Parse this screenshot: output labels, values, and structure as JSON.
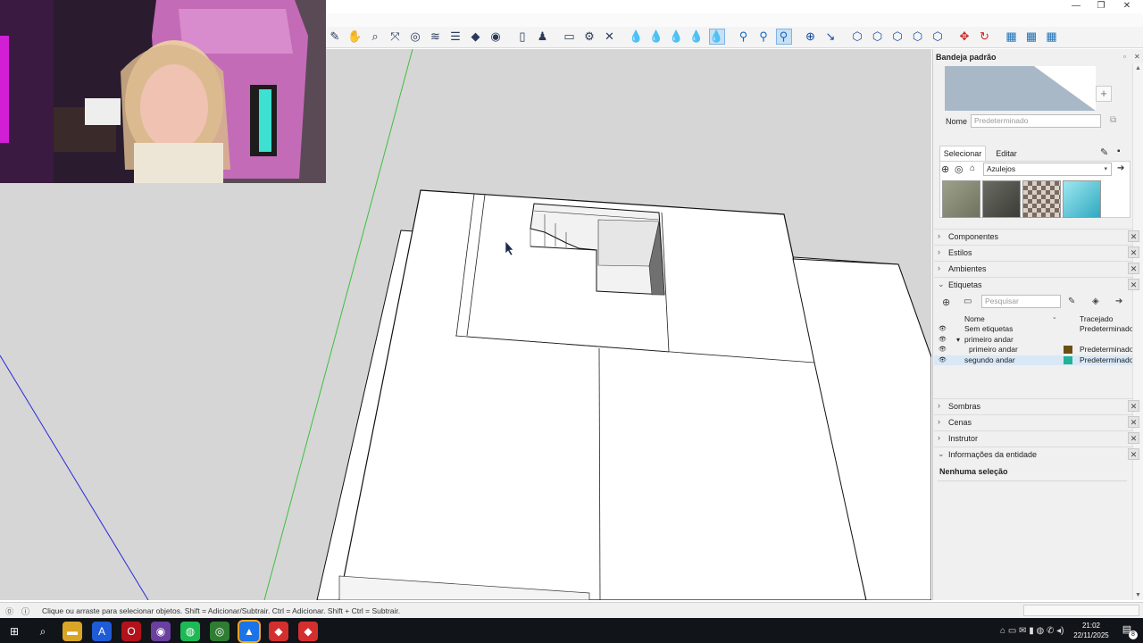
{
  "window": {
    "minimize": "—",
    "restore": "❐",
    "close": "✕"
  },
  "toolbar": {
    "icons": [
      "erase-icon",
      "pan-icon",
      "zoom-icon",
      "zoom-extents-icon",
      "orbit-icon",
      "section-icon",
      "layers-icon",
      "materials-icon",
      "camera-icon",
      "new-icon",
      "user-icon",
      "rectangle-icon",
      "settings-icon",
      "delete-icon",
      "drop-icon",
      "drop-icon",
      "drop-icon",
      "drop-icon",
      "drop-icon",
      "magnet-icon",
      "magnet-icon",
      "magnet-icon",
      "add-icon",
      "measure-icon",
      "box-icon",
      "box-icon",
      "box-icon",
      "box-icon",
      "box-icon",
      "move-icon",
      "rotate-icon",
      "grid-icon",
      "grid-icon",
      "grid-icon"
    ]
  },
  "tray": {
    "title": "Bandeja padrão",
    "name_label": "Nome",
    "name_placeholder": "Predeterminado",
    "tab_select": "Selecionar",
    "tab_edit": "Editar",
    "library": "Azulejos",
    "materials": [
      "mat-stone",
      "mat-dark-stone",
      "mat-checker",
      "mat-ice"
    ],
    "sections_collapsed_top": [
      "Componentes",
      "Estilos",
      "Ambientes"
    ],
    "tags_section": "Etiquetas",
    "tags_search_placeholder": "Pesquisar",
    "tags_col_name": "Nome",
    "tags_col_dashes": "Tracejado",
    "tags": [
      {
        "name": "Sem etiquetas",
        "dash": "Predeterminado",
        "color": "",
        "indent": 0
      },
      {
        "name": "primeiro andar",
        "dash": "",
        "color": "",
        "indent": 0,
        "group": true
      },
      {
        "name": "primeiro andar",
        "dash": "Predeterminado",
        "color": "#6b4e12",
        "indent": 1
      },
      {
        "name": "segundo andar",
        "dash": "Predeterminado",
        "color": "#1fb49a",
        "indent": 0,
        "selected": true
      }
    ],
    "sections_collapsed_bottom": [
      "Sombras",
      "Cenas",
      "Instrutor"
    ],
    "entity_section": "Informações da entidade",
    "entity_text": "Nenhuma seleção"
  },
  "status": {
    "text": "Clique ou arraste para selecionar objetos. Shift = Adicionar/Subtrair. Ctrl = Adicionar. Shift + Ctrl = Subtrair."
  },
  "taskbar": {
    "time": "21:02",
    "date": "22/11/2025",
    "notification_count": "8",
    "apps": [
      "windows-icon",
      "search-icon",
      "folder-icon",
      "app-a-icon",
      "opera-icon",
      "app-icon",
      "spotify-icon",
      "chrome-icon",
      "sketchup-icon",
      "app-red-icon",
      "app-red-icon"
    ]
  }
}
